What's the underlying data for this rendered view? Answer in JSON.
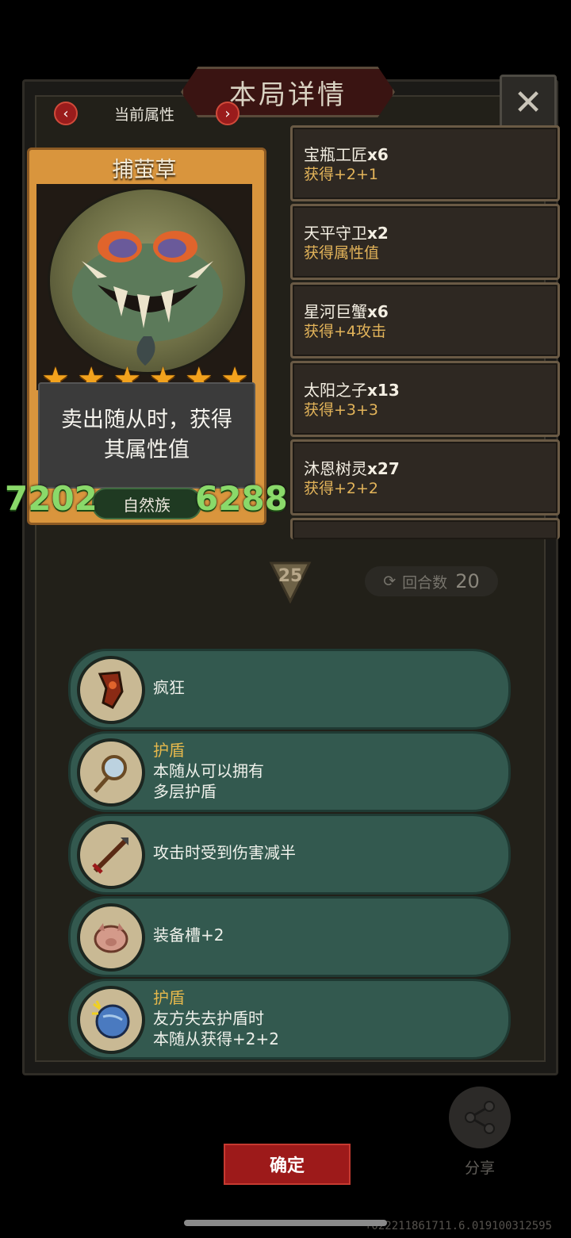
{
  "header": {
    "title": "本局详情",
    "close_icon": "close-icon"
  },
  "nav": {
    "label": "当前属性",
    "prev_icon": "chevron-left-icon",
    "next_icon": "chevron-right-icon"
  },
  "card": {
    "name": "捕萤草",
    "stars": 6,
    "description": "卖出随从时，获得其属性值",
    "attack": "7202",
    "health": "6288",
    "tribe": "自然族"
  },
  "buffs": [
    {
      "name": "宝瓶工匠",
      "count": "x6",
      "gain": "获得+2+1"
    },
    {
      "name": "天平守卫",
      "count": "x2",
      "gain": "获得属性值"
    },
    {
      "name": "星河巨蟹",
      "count": "x6",
      "gain": "获得+4攻击"
    },
    {
      "name": "太阳之子",
      "count": "x13",
      "gain": "获得+3+3"
    },
    {
      "name": "沐恩树灵",
      "count": "x27",
      "gain": "获得+2+2"
    }
  ],
  "round": {
    "number": "25",
    "turns_label": "回合数",
    "turns_value": "20"
  },
  "abilities": [
    {
      "icon": "rage-mask-icon",
      "lines": [
        "疯狂"
      ]
    },
    {
      "icon": "shield-mirror-icon",
      "keyword": "护盾",
      "lines": [
        "本随从可以拥有",
        "多层护盾"
      ]
    },
    {
      "icon": "arrow-icon",
      "lines": [
        "攻击时受到伤害减半"
      ]
    },
    {
      "icon": "pig-icon",
      "lines": [
        "装备槽+2"
      ]
    },
    {
      "icon": "planet-icon",
      "keyword": "护盾",
      "lines": [
        "友方失去护盾时",
        "本随从获得+2+2"
      ]
    }
  ],
  "footer": {
    "confirm_label": "确定",
    "share_label": "分享",
    "version": "+022211861711.6.019100312595"
  },
  "colors": {
    "accent_gold": "#e3b45a",
    "stat_green": "#8ad96a",
    "ability_bg": "#33594f",
    "confirm_red": "#9d1a1a"
  }
}
